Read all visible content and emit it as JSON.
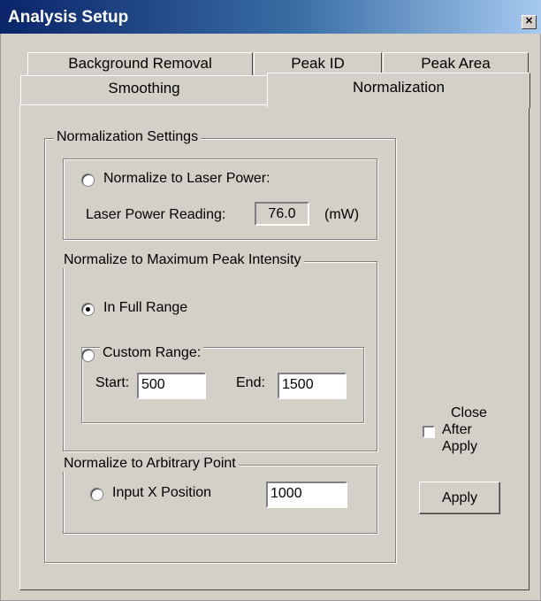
{
  "window": {
    "title": "Analysis Setup",
    "close_glyph": "✕"
  },
  "tabs": {
    "background_removal": "Background Removal",
    "peak_id": "Peak ID",
    "peak_area": "Peak Area",
    "smoothing": "Smoothing",
    "normalization": "Normalization",
    "active": "Normalization"
  },
  "normalization_settings": {
    "legend": "Normalization Settings",
    "laser": {
      "radio_label": "Normalize to Laser Power:",
      "selected": false,
      "reading_label": "Laser Power Reading:",
      "reading_value": "76.0",
      "unit": "(mW)"
    },
    "max_peak": {
      "legend": "Normalize to Maximum Peak Intensity",
      "full_range_label": "In Full Range",
      "full_range_selected": true,
      "custom_range_label": "Custom Range:",
      "custom_range_selected": false,
      "start_label": "Start:",
      "start_value": "500",
      "end_label": "End:",
      "end_value": "1500"
    },
    "arbitrary": {
      "legend": "Normalize to Arbitrary Point",
      "radio_label": "Input X Position",
      "selected": false,
      "value": "1000"
    }
  },
  "close_after_apply": {
    "line1": "Close",
    "line2": "After",
    "line3": "Apply",
    "checked": false
  },
  "apply_button": "Apply"
}
